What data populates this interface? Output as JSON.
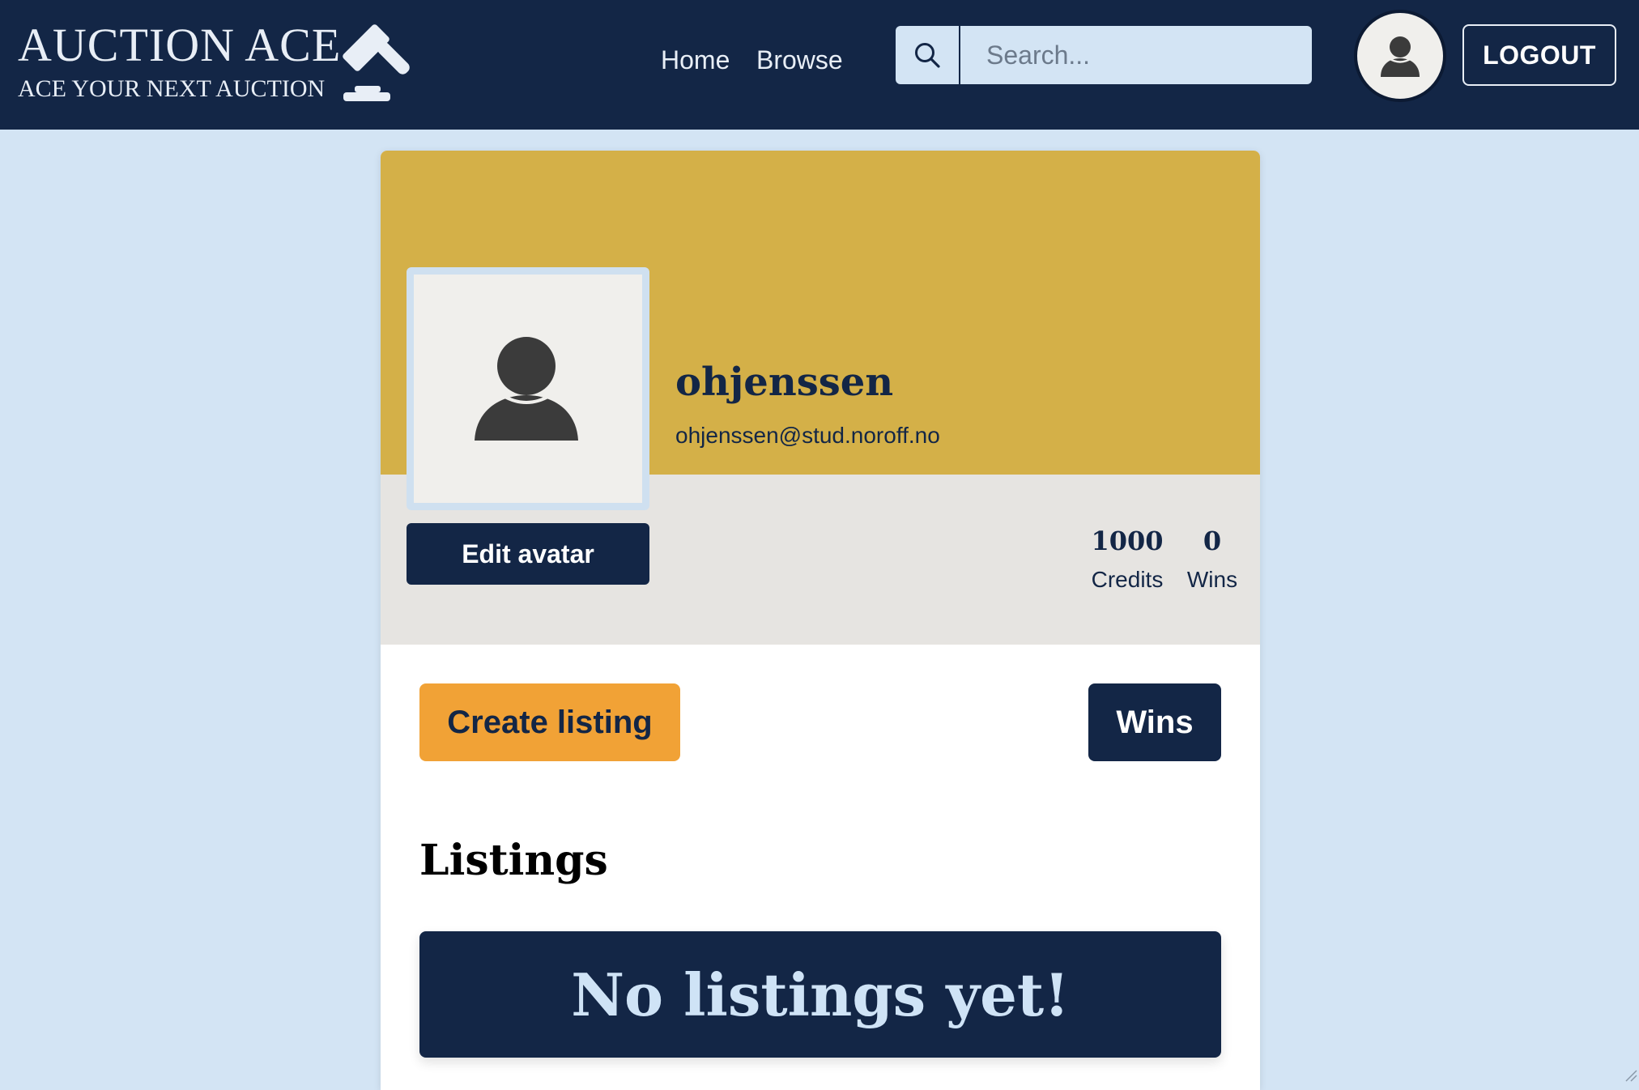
{
  "header": {
    "brand_title": "AUCTION ACE",
    "brand_tagline": "ACE YOUR NEXT AUCTION",
    "logo_icon": "gavel-icon",
    "nav": [
      {
        "label": "Home"
      },
      {
        "label": "Browse"
      }
    ],
    "search": {
      "placeholder": "Search...",
      "icon": "search-icon",
      "value": ""
    },
    "avatar_icon": "user-icon",
    "logout_label": "LOGOUT"
  },
  "profile": {
    "username": "ohjenssen",
    "email": "ohjenssen@stud.noroff.no",
    "avatar_icon": "user-icon",
    "edit_avatar_label": "Edit avatar",
    "stats": [
      {
        "value": "1000",
        "label": "Credits"
      },
      {
        "value": "0",
        "label": "Wins"
      }
    ]
  },
  "actions": {
    "create_listing_label": "Create listing",
    "wins_label": "Wins"
  },
  "listings": {
    "heading": "Listings",
    "empty_message": "No listings yet!"
  },
  "colors": {
    "navy": "#132646",
    "page_background": "#d3e4f4",
    "banner_gold": "#d4b048",
    "profile_band": "#e6e4e1",
    "create_button_orange": "#f1a236"
  }
}
